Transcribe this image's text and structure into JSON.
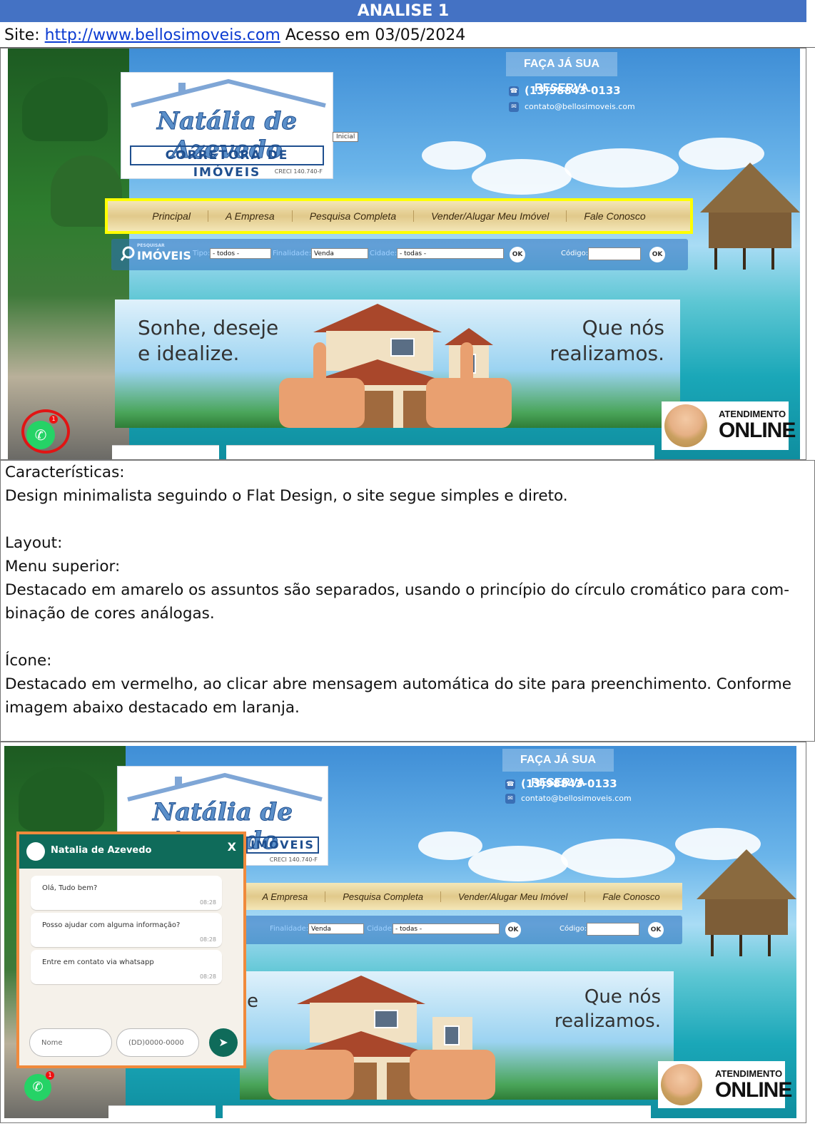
{
  "header": {
    "title": "ANALISE 1"
  },
  "site_line": {
    "prefix": "Site:",
    "url": "http://www.bellosimoveis.com",
    "access": "Acesso em 03/05/2024"
  },
  "website": {
    "logo_script": "Natália de Azevedo",
    "logo_subtitle": "CORRETORA DE IMÓVEIS",
    "logo_subtitle_short": "IMÓVEIS",
    "creci": "CRECI 140.740-F",
    "inicial": "Inicial",
    "reserva": "FAÇA JÁ SUA RESERVA",
    "phone": "(13)98843-0133",
    "email": "contato@bellosimoveis.com",
    "menu": [
      "Principal",
      "A Empresa",
      "Pesquisa Completa",
      "Vender/Alugar Meu Imóvel",
      "Fale Conosco"
    ],
    "search": {
      "logo_small": "PESQUISAR",
      "logo": "IMÓVEIS",
      "tipo_label": "Tipo:",
      "tipo_value": "- todos -",
      "finalidade_label": "Finalidade:",
      "finalidade_value": "Venda",
      "cidade_label": "Cidade:",
      "cidade_value": "- todas -",
      "ok": "OK",
      "codigo_label": "Código:"
    },
    "banner_left": [
      "Sonhe, deseje",
      "e idealize."
    ],
    "banner_right": [
      "Que nós",
      "realizamos."
    ],
    "online_line1": "ATENDIMENTO",
    "online_line2": "ONLINE",
    "whatsapp_badge": "1"
  },
  "text_section": {
    "lines": [
      "Características:",
      "Design minimalista seguindo o Flat Design, o site segue simples e direto.",
      "",
      "Layout:",
      "Menu superior:",
      "Destacado em amarelo os assuntos são separados, usando o princípio do círculo cromático para com-",
      "binação de cores análogas.",
      "",
      "Ícone:",
      "Destacado em vermelho, ao clicar abre mensagem automática do site para preenchimento. Conforme",
      "imagem abaixo destacado em laranja."
    ]
  },
  "chat": {
    "name": "Natalia de Azevedo",
    "close": "X",
    "messages": [
      {
        "text": "Olá, Tudo bem?",
        "time": "08:28"
      },
      {
        "text": "Posso ajudar com alguma informação?",
        "time": "08:28"
      },
      {
        "text": "Entre em contato via whatsapp",
        "time": "08:28"
      }
    ],
    "name_placeholder": "Nome",
    "phone_placeholder": "(DD)0000-0000",
    "banner_fragment": "e"
  },
  "colors": {
    "header_blue": "#4472c4",
    "highlight_yellow": "#ffff00",
    "highlight_red": "#e11414",
    "highlight_orange": "#f08a3c",
    "chat_green": "#0f6b5a"
  }
}
